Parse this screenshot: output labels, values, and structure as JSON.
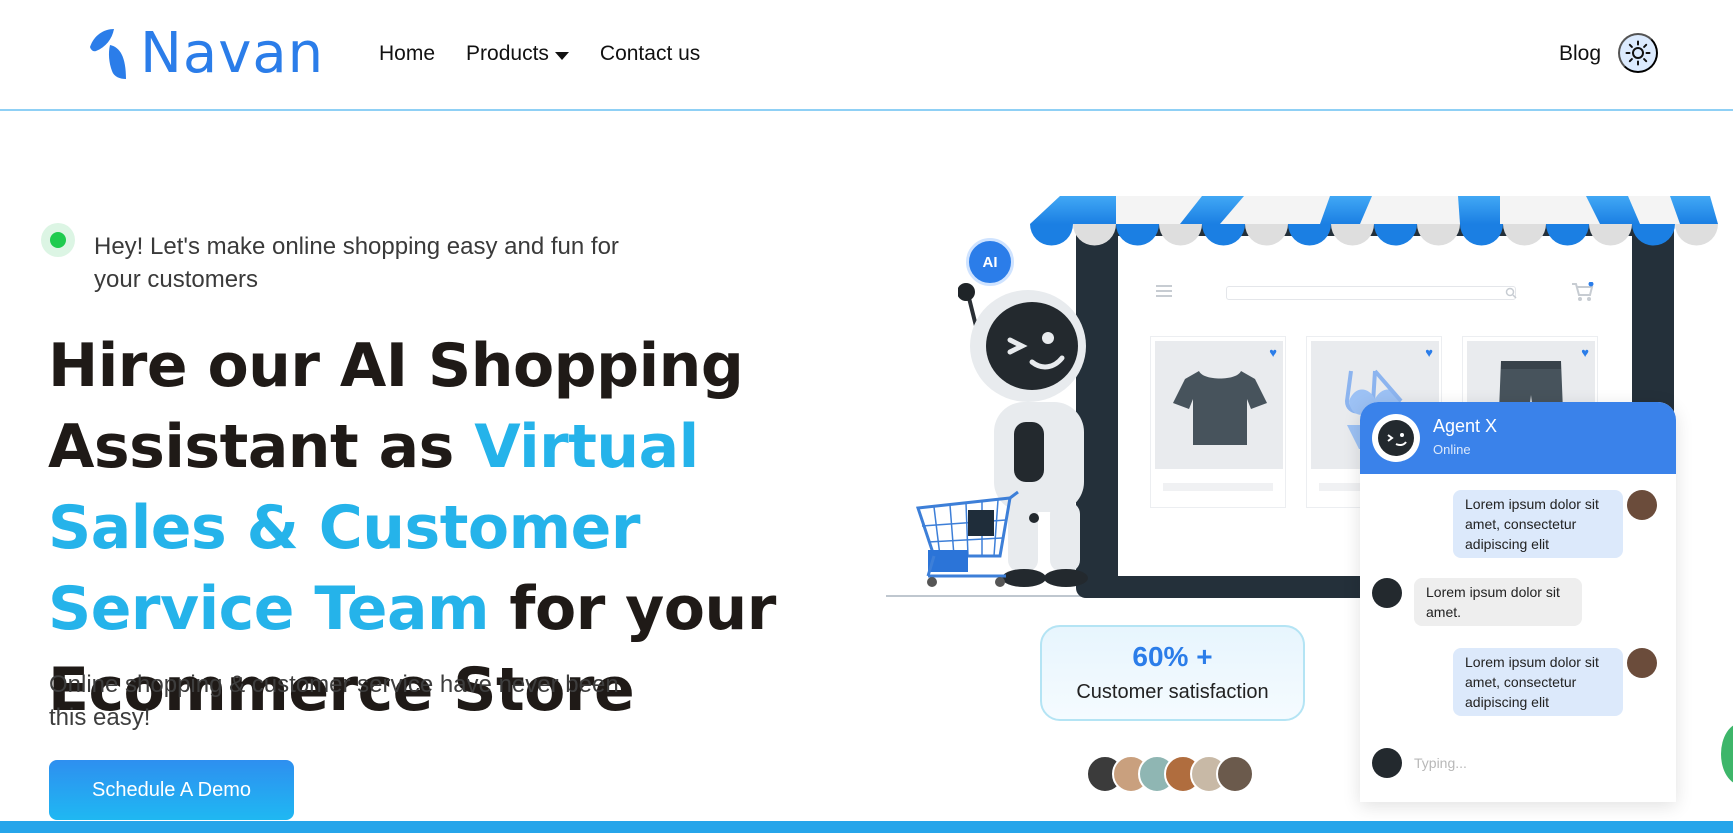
{
  "header": {
    "logo_text": "Navan",
    "nav": {
      "home": "Home",
      "products": "Products",
      "contact": "Contact us"
    },
    "blog": "Blog"
  },
  "hero": {
    "tagline": "Hey! Let's make online shopping easy and fun for your customers",
    "headline_part1": "Hire our AI Shopping Assistant as ",
    "headline_accent": "Virtual Sales & Customer Service Team",
    "headline_part2": " for your Ecommerce Store",
    "subtext": "Online shopping & customer service have never been this easy!",
    "cta_label": "Schedule A Demo"
  },
  "illustration": {
    "ai_badge": "AI",
    "satisfaction_value": "60% +",
    "satisfaction_label": "Customer satisfaction",
    "chat": {
      "agent_name": "Agent X",
      "agent_status": "Online",
      "messages": [
        "Lorem ipsum dolor sit amet, consectetur adipiscing elit",
        "Lorem ipsum dolor sit amet.",
        "Lorem ipsum dolor sit amet, consectetur adipiscing elit"
      ],
      "typing": "Typing..."
    }
  },
  "colors": {
    "brand_blue": "#2b7de9",
    "accent_cyan": "#25b3ea",
    "online_green": "#1fcb4f"
  },
  "icons": {
    "theme_toggle": "sun-icon",
    "products_caret": "caret-down-icon"
  }
}
